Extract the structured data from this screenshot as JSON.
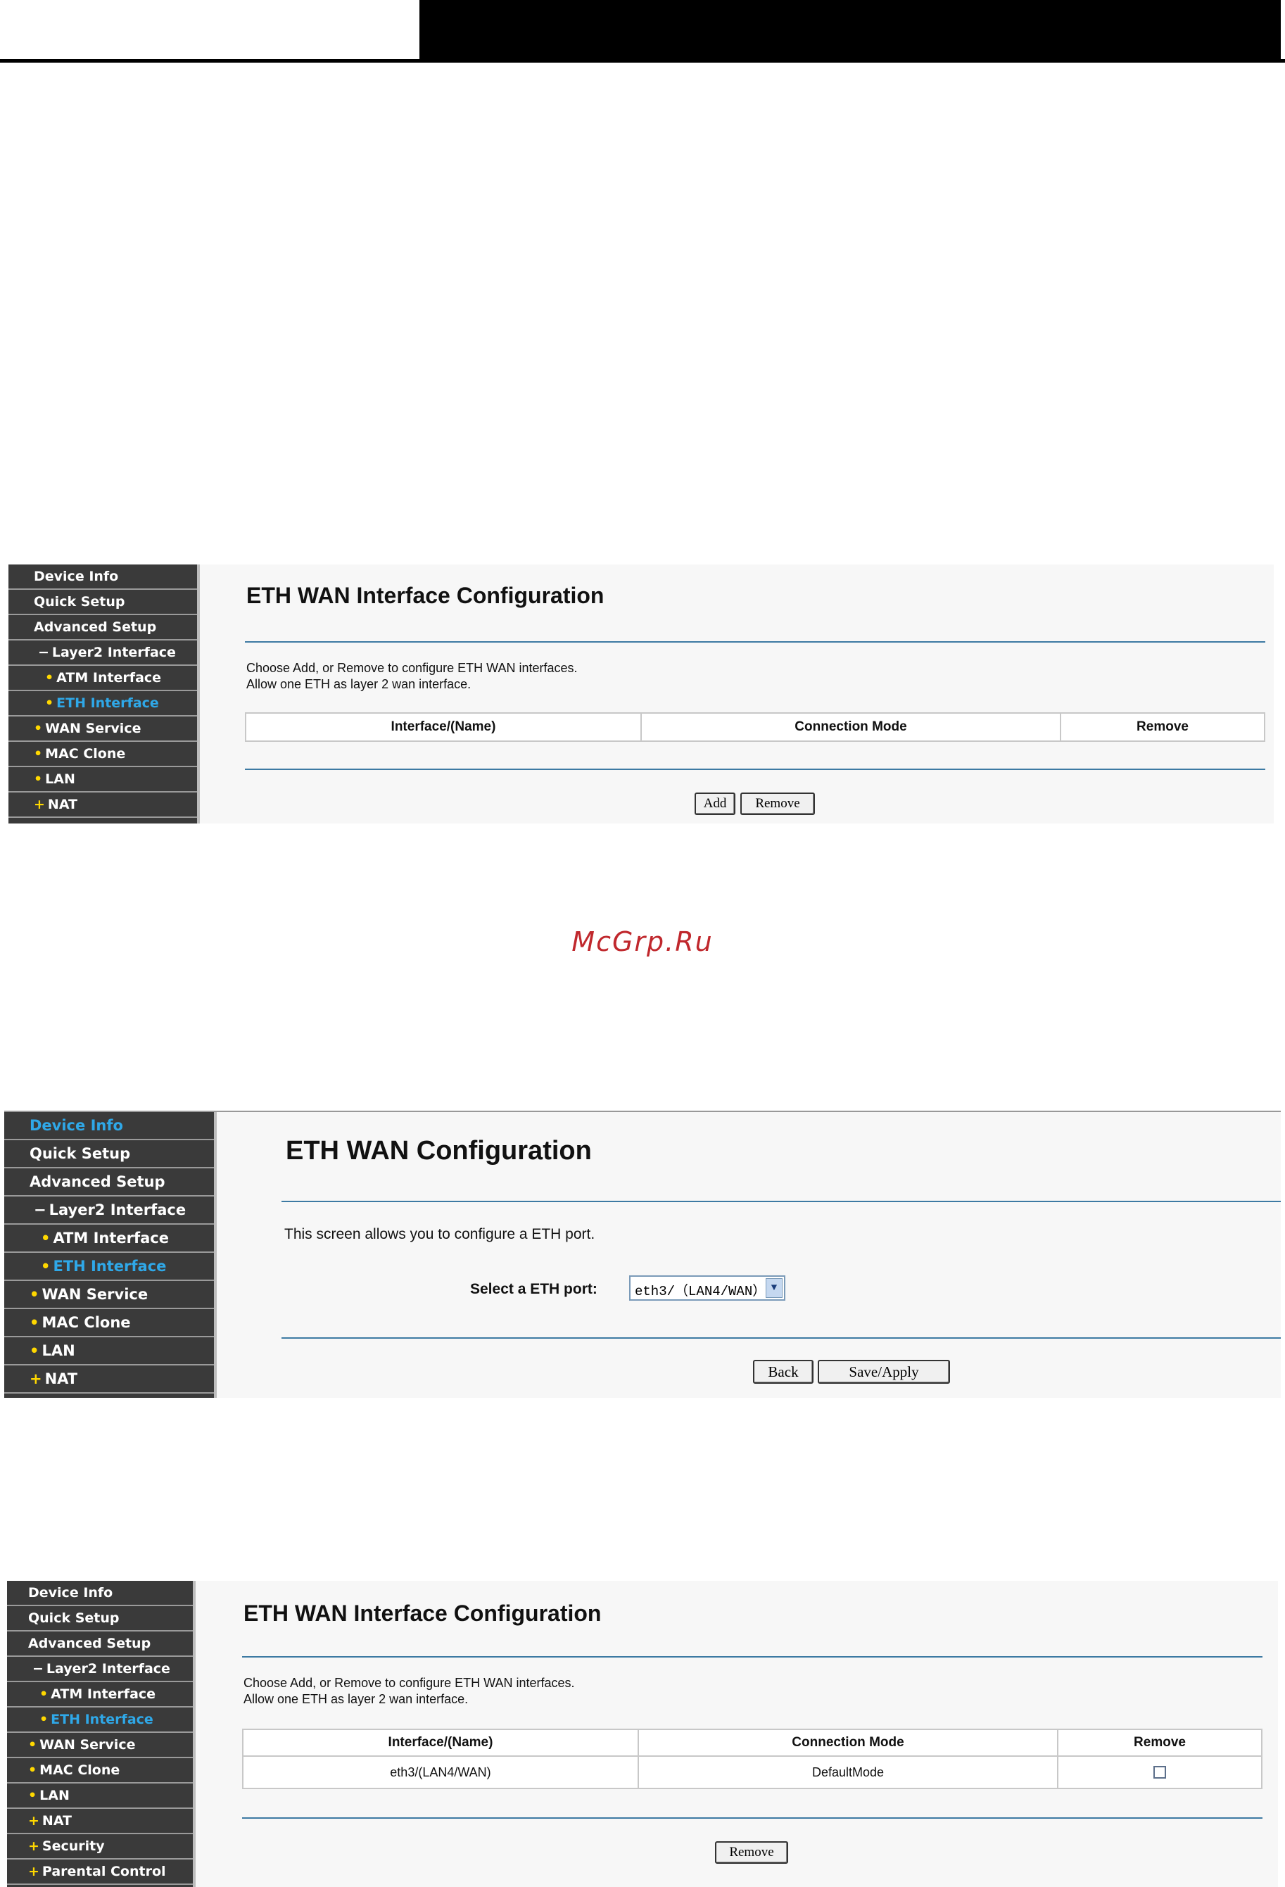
{
  "watermark": "McGrp.Ru",
  "screen1": {
    "nav": [
      {
        "label": "Device Info",
        "prefix": "",
        "active": false
      },
      {
        "label": "Quick Setup",
        "prefix": "",
        "active": false
      },
      {
        "label": "Advanced Setup",
        "prefix": "",
        "active": false
      },
      {
        "label": "Layer2 Interface",
        "prefix": "−",
        "active": false
      },
      {
        "label": "ATM Interface",
        "prefix": "•",
        "active": false
      },
      {
        "label": "ETH Interface",
        "prefix": "•",
        "active": true
      },
      {
        "label": "WAN Service",
        "prefix": "•",
        "active": false
      },
      {
        "label": "MAC Clone",
        "prefix": "•",
        "active": false
      },
      {
        "label": "LAN",
        "prefix": "•",
        "active": false
      },
      {
        "label": "NAT",
        "prefix": "+",
        "active": false
      }
    ],
    "title": "ETH WAN Interface Configuration",
    "desc_line1": "Choose Add, or Remove to configure ETH WAN interfaces.",
    "desc_line2": "Allow one ETH as layer 2 wan interface.",
    "columns": [
      "Interface/(Name)",
      "Connection Mode",
      "Remove"
    ],
    "add_label": "Add",
    "remove_label": "Remove"
  },
  "screen2": {
    "nav": [
      {
        "label": "Device Info",
        "prefix": "",
        "active": true
      },
      {
        "label": "Quick Setup",
        "prefix": "",
        "active": false
      },
      {
        "label": "Advanced Setup",
        "prefix": "",
        "active": false
      },
      {
        "label": "Layer2 Interface",
        "prefix": "−",
        "active": false
      },
      {
        "label": "ATM Interface",
        "prefix": "•",
        "active": false
      },
      {
        "label": "ETH Interface",
        "prefix": "•",
        "active": true
      },
      {
        "label": "WAN Service",
        "prefix": "•",
        "active": false
      },
      {
        "label": "MAC Clone",
        "prefix": "•",
        "active": false
      },
      {
        "label": "LAN",
        "prefix": "•",
        "active": false
      },
      {
        "label": "NAT",
        "prefix": "+",
        "active": false
      }
    ],
    "title": "ETH WAN Configuration",
    "desc": "This screen allows you to configure a ETH port.",
    "port_label": "Select a ETH port:",
    "port_value": "eth3/（LAN4/WAN）",
    "back_label": "Back",
    "save_label": "Save/Apply"
  },
  "screen3": {
    "nav": [
      {
        "label": "Device Info",
        "prefix": "",
        "active": false
      },
      {
        "label": "Quick Setup",
        "prefix": "",
        "active": false
      },
      {
        "label": "Advanced Setup",
        "prefix": "",
        "active": false
      },
      {
        "label": "Layer2 Interface",
        "prefix": "−",
        "active": false
      },
      {
        "label": "ATM Interface",
        "prefix": "•",
        "active": false
      },
      {
        "label": "ETH Interface",
        "prefix": "•",
        "active": true
      },
      {
        "label": "WAN Service",
        "prefix": "•",
        "active": false
      },
      {
        "label": "MAC Clone",
        "prefix": "•",
        "active": false
      },
      {
        "label": "LAN",
        "prefix": "•",
        "active": false
      },
      {
        "label": "NAT",
        "prefix": "+",
        "active": false
      },
      {
        "label": "Security",
        "prefix": "+",
        "active": false
      },
      {
        "label": "Parental Control",
        "prefix": "+",
        "active": false
      }
    ],
    "title": "ETH WAN Interface Configuration",
    "desc_line1": "Choose Add, or Remove to configure ETH WAN interfaces.",
    "desc_line2": "Allow one ETH as layer 2 wan interface.",
    "columns": [
      "Interface/(Name)",
      "Connection Mode",
      "Remove"
    ],
    "rows": [
      {
        "interface": "eth3/(LAN4/WAN)",
        "mode": "DefaultMode",
        "remove_checked": false
      }
    ],
    "remove_label": "Remove"
  },
  "colors": {
    "active_nav": "#2fa8e8",
    "bullet": "#ffd800",
    "rule": "#3d7aa3",
    "watermark": "#c0282d"
  }
}
